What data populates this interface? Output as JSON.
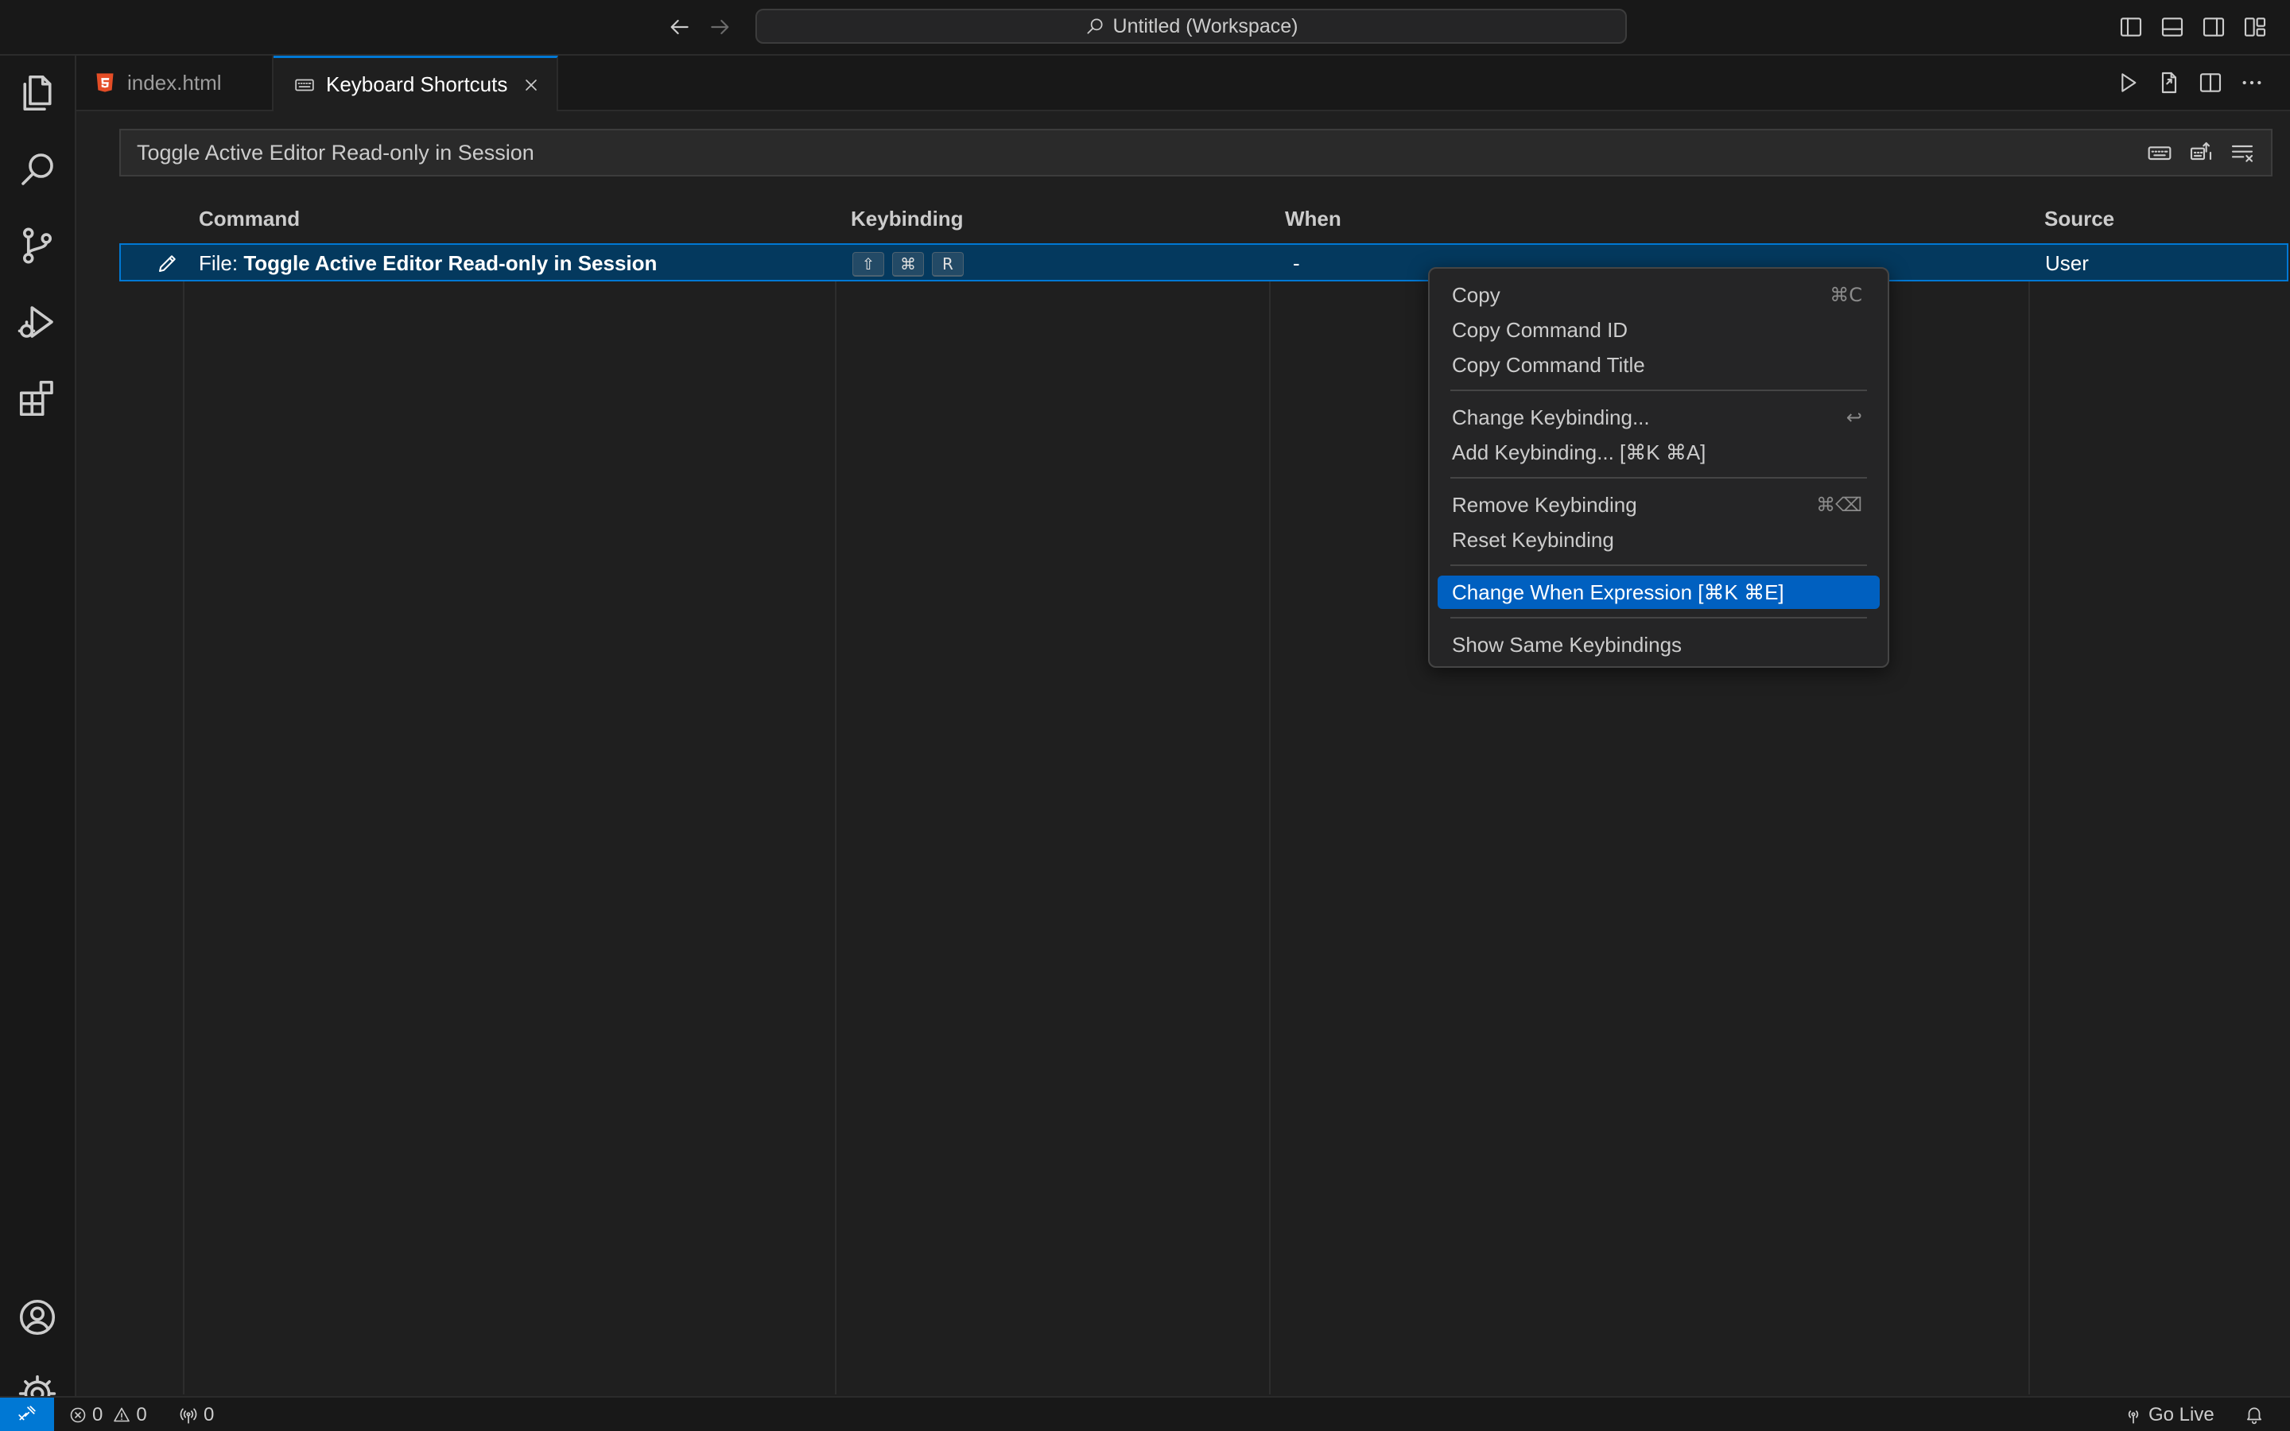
{
  "titlebar": {
    "search_text": "Untitled (Workspace)"
  },
  "tabs": [
    {
      "label": "index.html",
      "icon": "html5-icon"
    },
    {
      "label": "Keyboard Shortcuts",
      "icon": "keyboard-icon",
      "active": true
    }
  ],
  "search": {
    "value": "Toggle Active Editor Read-only in Session"
  },
  "table": {
    "columns": [
      "Command",
      "Keybinding",
      "When",
      "Source"
    ],
    "rows": [
      {
        "command_prefix": "File: ",
        "command_title": "Toggle Active Editor Read-only in Session",
        "keys": [
          "⇧",
          "⌘",
          "R"
        ],
        "when": "-",
        "source": "User"
      }
    ]
  },
  "context_menu": {
    "items": [
      {
        "label": "Copy",
        "shortcut": "⌘C"
      },
      {
        "label": "Copy Command ID",
        "shortcut": ""
      },
      {
        "label": "Copy Command Title",
        "shortcut": ""
      },
      {
        "label": "Change Keybinding...",
        "shortcut": "↩"
      },
      {
        "label": "Add Keybinding... [⌘K ⌘A]",
        "shortcut": ""
      },
      {
        "label": "Remove Keybinding",
        "shortcut": "⌘⌫"
      },
      {
        "label": "Reset Keybinding",
        "shortcut": ""
      },
      {
        "label": "Change When Expression [⌘K ⌘E]",
        "shortcut": "",
        "active": true
      },
      {
        "label": "Show Same Keybindings",
        "shortcut": ""
      }
    ]
  },
  "statusbar": {
    "errors": "0",
    "warnings": "0",
    "ports": "0",
    "go_live": "Go Live"
  },
  "colors": {
    "accent": "#0078d4",
    "menu_highlight": "#0060c0",
    "row_selected": "#04395e"
  }
}
